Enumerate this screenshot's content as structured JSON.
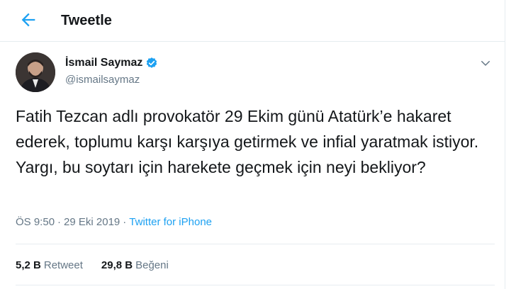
{
  "header": {
    "title": "Tweetle",
    "back_icon": "arrow-left-icon",
    "accent": "#1da1f2"
  },
  "tweet": {
    "author_name": "İsmail Saymaz",
    "author_handle": "@ismailsaymaz",
    "verified_icon": "verified-badge-icon",
    "text": "Fatih Tezcan adlı provokatör 29 Ekim günü Atatürk’e hakaret ederek, toplumu karşı karşıya getirmek ve infial yaratmak istiyor. Yargı, bu soytarı için harekete geçmek için neyi bekliyor?",
    "time": "ÖS 9:50",
    "separator": "·",
    "date": "29 Eki 2019",
    "source": "Twitter for iPhone"
  },
  "stats": {
    "retweets_count": "5,2 B",
    "retweets_label": "Retweet",
    "likes_count": "29,8 B",
    "likes_label": "Beğeni"
  }
}
